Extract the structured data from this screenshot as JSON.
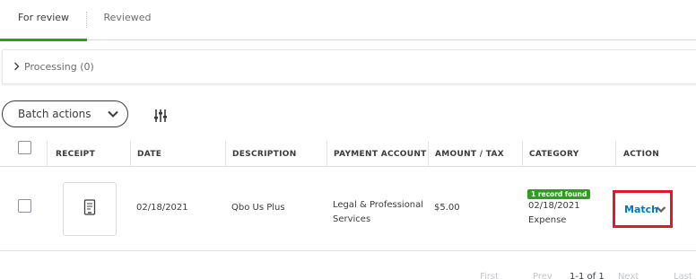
{
  "tabs": [
    {
      "label": "For review",
      "active": true
    },
    {
      "label": "Reviewed",
      "active": false
    }
  ],
  "processing": {
    "label": "Processing (0)"
  },
  "toolbar": {
    "batch_label": "Batch actions"
  },
  "table": {
    "headers": {
      "receipt": "RECEIPT",
      "date": "DATE",
      "description": "DESCRIPTION",
      "payment_account": "PAYMENT ACCOUNT",
      "amount": "AMOUNT / TAX",
      "category": "CATEGORY",
      "action": "ACTION"
    },
    "rows": [
      {
        "date": "02/18/2021",
        "description": "Qbo Us Plus",
        "payment_account_line1": "Legal & Professional",
        "payment_account_line2": "Services",
        "amount": "$5.00",
        "badge": "1 record found",
        "category_line1": "02/18/2021",
        "category_line2": "Expense",
        "action": "Match"
      }
    ]
  },
  "pagination": {
    "first": "First",
    "prev": "Prev",
    "range": "1-1 of 1",
    "next": "Next",
    "last": "Last"
  },
  "colors": {
    "accent_green": "#2ca01c",
    "link_blue": "#0077c5",
    "highlight_red": "#e01a2b"
  }
}
